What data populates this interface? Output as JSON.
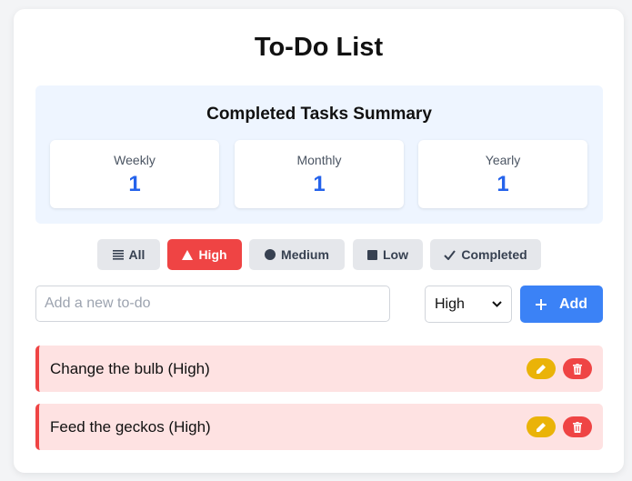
{
  "app": {
    "title": "To-Do List"
  },
  "summary": {
    "title": "Completed Tasks Summary",
    "stats": [
      {
        "label": "Weekly",
        "value": "1"
      },
      {
        "label": "Monthly",
        "value": "1"
      },
      {
        "label": "Yearly",
        "value": "1"
      }
    ]
  },
  "filters": [
    {
      "label": "All",
      "icon": "list-icon",
      "active": false
    },
    {
      "label": "High",
      "icon": "triangle-icon",
      "active": true
    },
    {
      "label": "Medium",
      "icon": "circle-icon",
      "active": false
    },
    {
      "label": "Low",
      "icon": "square-icon",
      "active": false
    },
    {
      "label": "Completed",
      "icon": "check-icon",
      "active": false
    }
  ],
  "new_todo": {
    "placeholder": "Add a new to-do",
    "value": "",
    "priority_selected": "High",
    "add_label": "Add"
  },
  "todos": [
    {
      "text": "Change the bulb (High)",
      "priority": "High"
    },
    {
      "text": "Feed the geckos (High)",
      "priority": "High"
    }
  ],
  "colors": {
    "accent_blue": "#3b82f6",
    "high_red": "#ef4444",
    "edit_yellow": "#eab308",
    "stat_blue": "#2563eb"
  }
}
